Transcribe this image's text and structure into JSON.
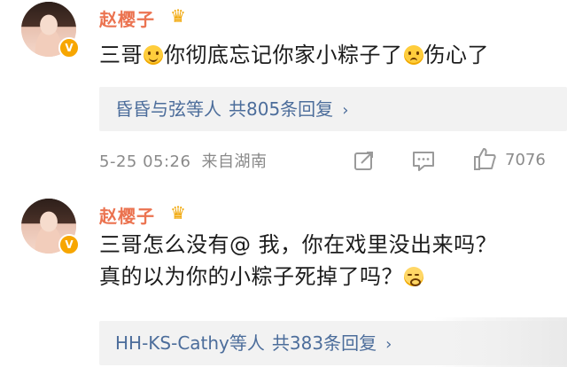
{
  "comments": [
    {
      "username": "赵樱子",
      "verified_badge": "V",
      "text_parts": [
        "三哥",
        "你彻底忘记你家小粽子了",
        "伤心了"
      ],
      "emojis": [
        "smile-emoji",
        "sad-emoji"
      ],
      "replies": {
        "names": "昏昏与弦等人",
        "count": "共805条回复",
        "chevron": "›"
      },
      "meta": {
        "timestamp": "5-25 05:26",
        "source": "来自湖南"
      },
      "likes": "7076"
    },
    {
      "username": "赵樱子",
      "verified_badge": "V",
      "text_line1": "三哥怎么没有@ 我，你在戏里没出来吗？",
      "text_line2": "真的以为你的小粽子死掉了吗？",
      "emojis": [
        "cry-emoji"
      ],
      "replies": {
        "names": "HH-KS-Cathy等人",
        "count": "共383条回复",
        "chevron": "›"
      }
    }
  ],
  "icons": {
    "crown": "crown-icon",
    "share": "share-icon",
    "comment": "comment-icon",
    "like": "like-icon"
  },
  "colors": {
    "username": "#eb7350",
    "reply_link": "#4c6d9b",
    "meta_text": "#8a8a8a",
    "vip_badge": "#f7a600"
  }
}
